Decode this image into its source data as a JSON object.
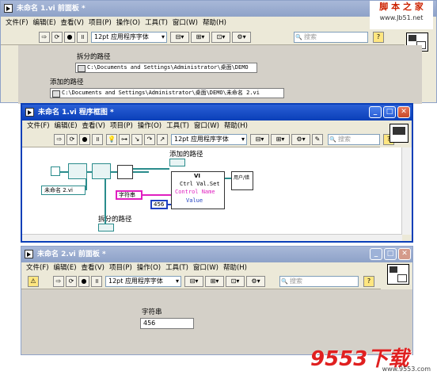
{
  "win1": {
    "title": "未命名 1.vi 前面板 *",
    "menu": [
      "文件(F)",
      "编辑(E)",
      "查看(V)",
      "项目(P)",
      "操作(O)",
      "工具(T)",
      "窗口(W)",
      "帮助(H)"
    ],
    "font": "12pt 应用程序字体",
    "search_placeholder": "搜索",
    "split_path_label": "拆分的路径",
    "split_path_value": "C:\\Documents and Settings\\Administrator\\桌面\\DEMO",
    "added_path_label": "添加的路径",
    "added_path_value": "C:\\Documents and Settings\\Administrator\\桌面\\DEMO\\未命名 2.vi"
  },
  "win2": {
    "title": "未命名 1.vi 程序框图 *",
    "menu": [
      "文件(F)",
      "编辑(E)",
      "查看(V)",
      "项目(P)",
      "操作(O)",
      "工具(T)",
      "窗口(W)",
      "帮助(H)"
    ],
    "font": "12pt 应用程序字体",
    "search_placeholder": "搜索",
    "added_path_label": "添加的路径",
    "vi_label": "VI",
    "ctrl_val_set": "Ctrl Val.Set",
    "control_name": "Control Name",
    "value_label": "Value",
    "string_label": "字符串",
    "const_456": "456",
    "file_const": "未命名 2.vi",
    "split_path_label": "拆分的路径",
    "convert_label": "用户/错"
  },
  "win3": {
    "title": "未命名 2.vi 前面板 *",
    "menu": [
      "文件(F)",
      "编辑(E)",
      "查看(V)",
      "项目(P)",
      "操作(O)",
      "工具(T)",
      "窗口(W)",
      "帮助(H)"
    ],
    "font": "12pt 应用程序字体",
    "search_placeholder": "搜索",
    "string_label": "字符串",
    "string_value": "456"
  },
  "watermark": {
    "top": "脚 本 之 家",
    "top_url": "www.Jb51.net",
    "bottom": "9553下载",
    "bottom_url": "www.9553.com"
  },
  "colors": {
    "title_active": "#0a3fb8",
    "title_inactive": "#8ea2c8",
    "wire_path": "#2a8c8c",
    "wire_string": "#e020c0",
    "wire_number": "#2040c0"
  }
}
